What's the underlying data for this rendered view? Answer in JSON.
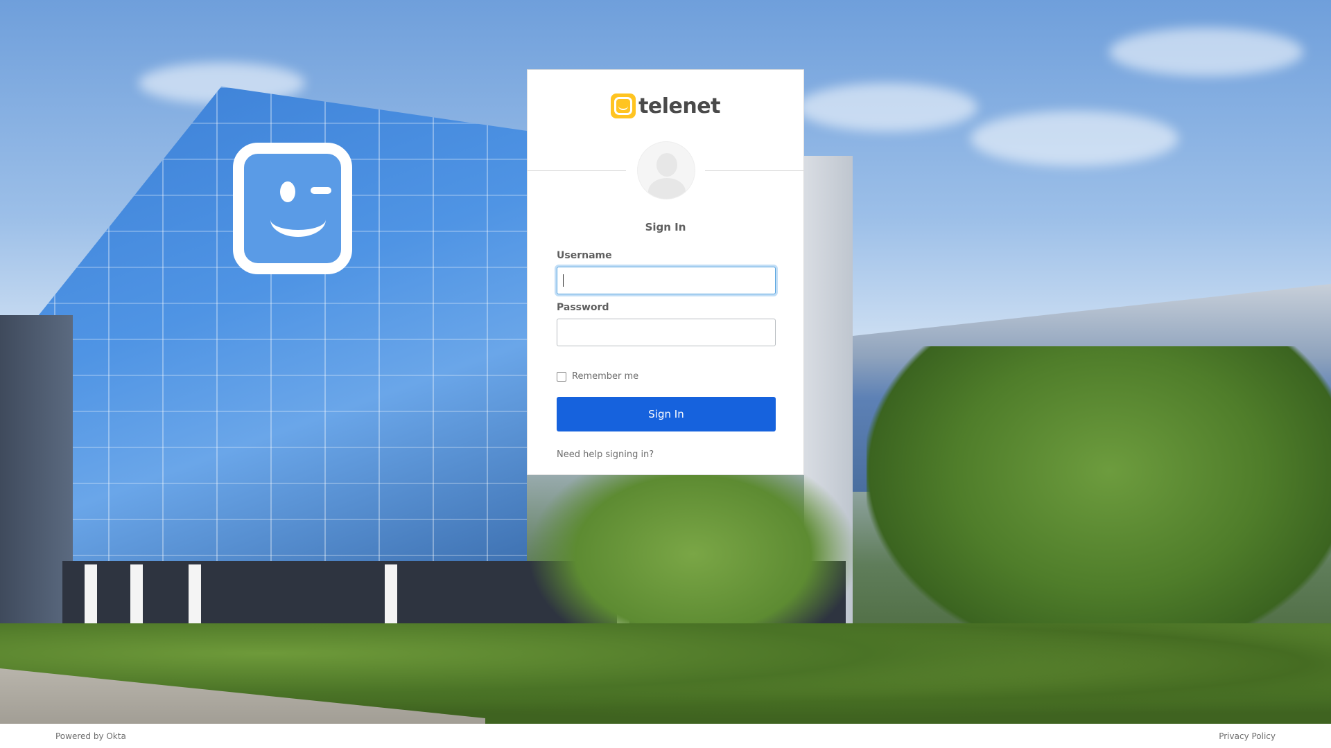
{
  "brand": {
    "name": "telenet",
    "accent_color": "#ffc421"
  },
  "form": {
    "title": "Sign In",
    "username_label": "Username",
    "username_value": "",
    "password_label": "Password",
    "password_value": "",
    "remember_label": "Remember me",
    "remember_checked": false,
    "submit_label": "Sign In",
    "submit_color": "#1662dd",
    "help_link": "Need help signing in?"
  },
  "footer": {
    "powered_by": "Powered by Okta",
    "privacy": "Privacy Policy"
  }
}
